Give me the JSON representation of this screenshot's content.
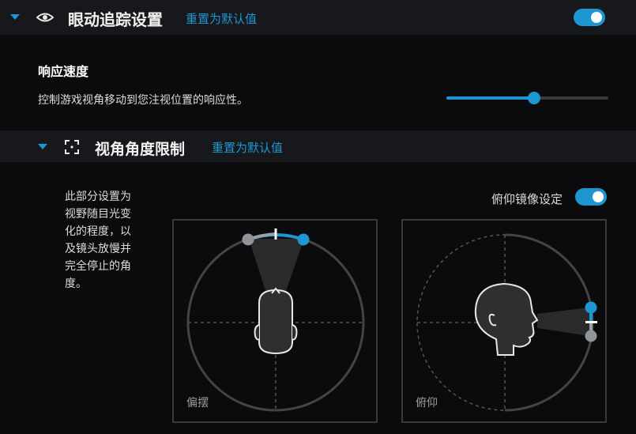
{
  "header": {
    "title": "眼动追踪设置",
    "reset_label": "重置为默认值",
    "icon": "eye-icon",
    "toggle_on": true
  },
  "response": {
    "title": "响应速度",
    "description": "控制游戏视角移动到您注视位置的响应性。",
    "slider_value": 0.54
  },
  "view_limit": {
    "title": "视角角度限制",
    "reset_label": "重置为默认值",
    "icon": "focus-frame-icon",
    "note": [
      "此部分设置为",
      "视野随目光变",
      "化的程度，以",
      "及镜头放慢并",
      "完全停止的角",
      "度。"
    ],
    "mirror_label": "俯仰镜像设定",
    "mirror_on": true,
    "yaw_label": "偏摆",
    "pitch_label": "俯仰"
  },
  "colors": {
    "accent": "#1e96d2",
    "background": "#0b0b0d",
    "section_bar": "#17181b"
  }
}
